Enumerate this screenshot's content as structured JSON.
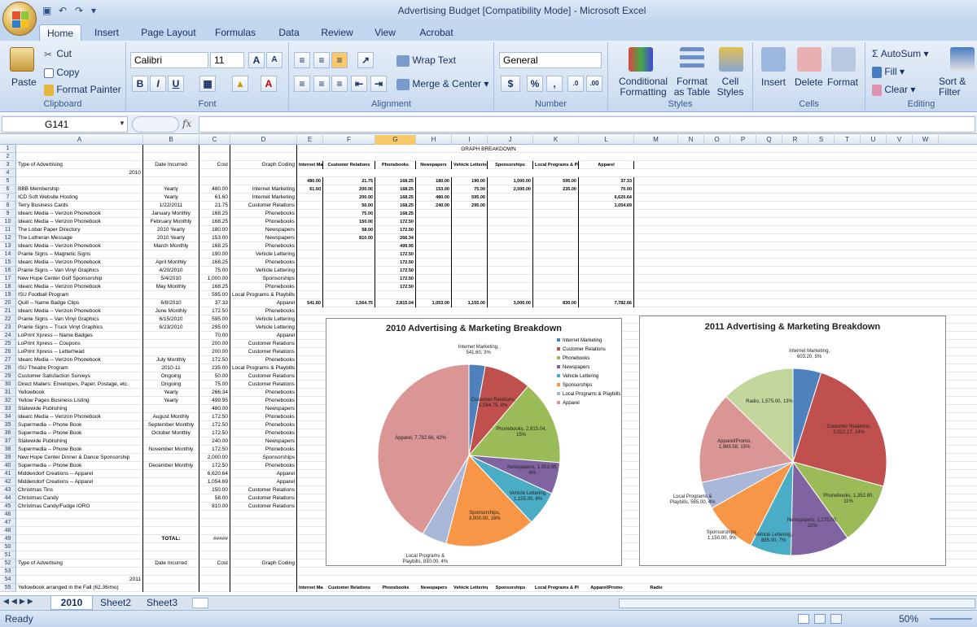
{
  "window": {
    "title": "Advertising Budget  [Compatibility Mode] - Microsoft Excel"
  },
  "ribbon": {
    "tabs": [
      "Home",
      "Insert",
      "Page Layout",
      "Formulas",
      "Data",
      "Review",
      "View",
      "Acrobat"
    ],
    "active_tab": "Home",
    "clipboard": {
      "paste": "Paste",
      "cut": "Cut",
      "copy": "Copy",
      "format_painter": "Format Painter",
      "label": "Clipboard"
    },
    "font": {
      "name": "Calibri",
      "size": "11",
      "label": "Font",
      "bold": "B",
      "italic": "I",
      "underline": "U"
    },
    "alignment": {
      "wrap": "Wrap Text",
      "merge": "Merge & Center",
      "label": "Alignment"
    },
    "number": {
      "format": "General",
      "currency": "$",
      "percent": "%",
      "comma": ",",
      "label": "Number"
    },
    "styles": {
      "conditional": "Conditional Formatting",
      "format_table": "Format as Table",
      "cell_styles": "Cell Styles",
      "label": "Styles"
    },
    "cells": {
      "insert": "Insert",
      "delete": "Delete",
      "format": "Format",
      "label": "Cells"
    },
    "editing": {
      "autosum": "AutoSum",
      "fill": "Fill",
      "clear": "Clear",
      "sort": "Sort & Filter",
      "label": "Editing"
    }
  },
  "formula_bar": {
    "name_box": "G141",
    "fx": "fx",
    "value": ""
  },
  "columns": [
    "A",
    "B",
    "C",
    "D",
    "E",
    "F",
    "G",
    "H",
    "I",
    "J",
    "K",
    "L",
    "M",
    "N",
    "O",
    "P",
    "Q",
    "R",
    "S",
    "T",
    "U",
    "V",
    "W"
  ],
  "selected_column": "G",
  "rows": [
    {
      "n": "1",
      "a": "",
      "b": "",
      "c": "",
      "d": ""
    },
    {
      "n": "2",
      "a": "",
      "b": "",
      "c": "",
      "d": ""
    },
    {
      "n": "3",
      "a": "Type of Advertising",
      "b": "Date Incurred",
      "c": "Cost",
      "d": "Graph Coding"
    },
    {
      "n": "4",
      "a": "2010",
      "b": "",
      "c": "",
      "d": ""
    },
    {
      "n": "5",
      "a": "",
      "b": "",
      "c": "",
      "d": ""
    },
    {
      "n": "6",
      "a": "BBB Membership",
      "b": "Yearly",
      "c": "480.00",
      "d": "Internet Marketing"
    },
    {
      "n": "7",
      "a": "ICD Soft Website Hosting",
      "b": "Yearly",
      "c": "61.60",
      "d": "Internet Marketing"
    },
    {
      "n": "8",
      "a": "Terry Business Cards",
      "b": "1/22/2011",
      "c": "21.75",
      "d": "Customer Relations"
    },
    {
      "n": "9",
      "a": "Idearc Media -- Verizon Phonebook",
      "b": "January Monthly",
      "c": "168.25",
      "d": "Phonebooks"
    },
    {
      "n": "10",
      "a": "Idearc Media -- Verizon Phonebook",
      "b": "February Monthly",
      "c": "168.25",
      "d": "Phonebooks"
    },
    {
      "n": "11",
      "a": "The Lobar Paper Directory",
      "b": "2010 Yearly",
      "c": "180.00",
      "d": "Newspapers"
    },
    {
      "n": "12",
      "a": "The Lutheran Message",
      "b": "2010 Yearly",
      "c": "153.00",
      "d": "Newspapers"
    },
    {
      "n": "13",
      "a": "Idearc Media -- Verizon Phonebook",
      "b": "March Monthly",
      "c": "168.25",
      "d": "Phonebooks"
    },
    {
      "n": "14",
      "a": "Prairie Signs -- Magnetic Signs",
      "b": "",
      "c": "190.00",
      "d": "Vehicle Lettering"
    },
    {
      "n": "15",
      "a": "Idearc Media -- Verizon Phonebook",
      "b": "April Monthly",
      "c": "168.25",
      "d": "Phonebooks"
    },
    {
      "n": "16",
      "a": "Prairie Signs -- Van Vinyl Graphics",
      "b": "4/20/2010",
      "c": "75.00",
      "d": "Vehicle Lettering"
    },
    {
      "n": "17",
      "a": "New Hope Center Golf Sponsorship",
      "b": "5/4/2010",
      "c": "1,000.00",
      "d": "Sponsorships"
    },
    {
      "n": "18",
      "a": "Idearc Media -- Verizon Phonebook",
      "b": "May Monthly",
      "c": "168.25",
      "d": "Phonebooks"
    },
    {
      "n": "19",
      "a": "ISU Football Program",
      "b": "",
      "c": "595.00",
      "d": "Local Programs & Playbills"
    },
    {
      "n": "20",
      "a": "Quill -- Name Badge Clips",
      "b": "6/8/2010",
      "c": "37.33",
      "d": "Apparel"
    },
    {
      "n": "21",
      "a": "Idearc Media -- Verizon Phonebook",
      "b": "June Monthly",
      "c": "172.50",
      "d": "Phonebooks"
    },
    {
      "n": "22",
      "a": "Prairie Signs -- Van Vinyl Graphics",
      "b": "6/15/2010",
      "c": "595.00",
      "d": "Vehicle Lettering"
    },
    {
      "n": "23",
      "a": "Prairie Signs -- Truck Vinyl Graphics",
      "b": "6/23/2010",
      "c": "295.00",
      "d": "Vehicle Lettering"
    },
    {
      "n": "24",
      "a": "LoPrint Xpress -- Name Badges",
      "b": "",
      "c": "70.00",
      "d": "Apparel"
    },
    {
      "n": "25",
      "a": "LoPrint Xpress -- Coupons",
      "b": "",
      "c": "200.00",
      "d": "Customer Relations"
    },
    {
      "n": "26",
      "a": "LoPrint Xpress -- Letterhead",
      "b": "",
      "c": "200.00",
      "d": "Customer Relations"
    },
    {
      "n": "27",
      "a": "Idearc Media -- Verizon Phonebook",
      "b": "July Monthly",
      "c": "172.50",
      "d": "Phonebooks"
    },
    {
      "n": "28",
      "a": "ISU Theatre Program",
      "b": "2010-11",
      "c": "235.00",
      "d": "Local Programs & Playbills"
    },
    {
      "n": "29",
      "a": "Customer Satisfaction Surveys",
      "b": "Ongoing",
      "c": "50.00",
      "d": "Customer Relations"
    },
    {
      "n": "30",
      "a": "Direct Mailers: Envelopes, Paper, Postage, etc.",
      "b": "Ongoing",
      "c": "75.00",
      "d": "Customer Relations"
    },
    {
      "n": "31",
      "a": "Yellowbook",
      "b": "Yearly",
      "c": "266.34",
      "d": "Phonebooks"
    },
    {
      "n": "32",
      "a": "Yellow Pages Business Listing",
      "b": "Yearly",
      "c": "499.95",
      "d": "Phonebooks"
    },
    {
      "n": "33",
      "a": "Statewide Publishing",
      "b": "",
      "c": "480.00",
      "d": "Newspapers"
    },
    {
      "n": "34",
      "a": "Idearc Media -- Verizon Phonebook",
      "b": "August Monthly",
      "c": "172.50",
      "d": "Phonebooks"
    },
    {
      "n": "35",
      "a": "Supermedia -- Phone Book",
      "b": "September Monthly",
      "c": "172.50",
      "d": "Phonebooks"
    },
    {
      "n": "36",
      "a": "Supermedia -- Phone Book",
      "b": "October Monthly",
      "c": "172.50",
      "d": "Phonebooks"
    },
    {
      "n": "37",
      "a": "Statewide Publishing",
      "b": "",
      "c": "240.00",
      "d": "Newspapers"
    },
    {
      "n": "38",
      "a": "Supermedia -- Phone Book",
      "b": "November Monthly",
      "c": "172.50",
      "d": "Phonebooks"
    },
    {
      "n": "39",
      "a": "New Hope Center Dinner & Dance Sponsorship",
      "b": "",
      "c": "2,000.00",
      "d": "Sponsorships"
    },
    {
      "n": "40",
      "a": "Supermedia -- Phone Book",
      "b": "December Monthly",
      "c": "172.50",
      "d": "Phonebooks"
    },
    {
      "n": "41",
      "a": "Middendorf Creations -- Apparel",
      "b": "",
      "c": "6,620.64",
      "d": "Apparel"
    },
    {
      "n": "42",
      "a": "Middendorf Creations -- Apparel",
      "b": "",
      "c": "1,054.69",
      "d": "Apparel"
    },
    {
      "n": "43",
      "a": "Christmas Tins",
      "b": "",
      "c": "150.00",
      "d": "Customer Relations"
    },
    {
      "n": "44",
      "a": "Christmas Candy",
      "b": "",
      "c": "58.00",
      "d": "Customer Relations"
    },
    {
      "n": "45",
      "a": "Christmas Candy/Fudge IORG",
      "b": "",
      "c": "810.00",
      "d": "Customer Relations"
    },
    {
      "n": "46",
      "a": "",
      "b": "",
      "c": "",
      "d": ""
    },
    {
      "n": "47",
      "a": "",
      "b": "",
      "c": "",
      "d": ""
    },
    {
      "n": "48",
      "a": "",
      "b": "",
      "c": "",
      "d": ""
    },
    {
      "n": "49",
      "a": "",
      "b": "TOTAL:",
      "c": "#####",
      "d": ""
    },
    {
      "n": "50",
      "a": "",
      "b": "",
      "c": "",
      "d": ""
    },
    {
      "n": "51",
      "a": "",
      "b": "",
      "c": "",
      "d": ""
    },
    {
      "n": "52",
      "a": "Type of Advertising",
      "b": "Date Incurred",
      "c": "Cost",
      "d": "Graph Coding"
    },
    {
      "n": "53",
      "a": "",
      "b": "",
      "c": "",
      "d": ""
    },
    {
      "n": "54",
      "a": "2011",
      "b": "",
      "c": "",
      "d": ""
    },
    {
      "n": "55",
      "a": "Yellowbook arranged in the Fall (62.36/mo)",
      "b": "",
      "c": "",
      "d": ""
    }
  ],
  "breakdown": {
    "title": "GRAPH BREAKDOWN",
    "headers": [
      "Internet Marketing",
      "Customer Relations",
      "Phonebooks",
      "Newspapers",
      "Vehicle Lettering",
      "Sponsorships",
      "Local Programs & Playbills",
      "Apparel"
    ],
    "rows": [
      [
        "480.00",
        "21.75",
        "168.25",
        "180.00",
        "190.00",
        "1,000.00",
        "595.00",
        "37.33"
      ],
      [
        "61.60",
        "200.00",
        "168.25",
        "153.00",
        "75.00",
        "2,000.00",
        "235.00",
        "70.00"
      ],
      [
        "",
        "200.00",
        "168.25",
        "480.00",
        "595.00",
        "",
        "",
        "6,620.64"
      ],
      [
        "",
        "50.00",
        "168.25",
        "240.00",
        "295.00",
        "",
        "",
        "1,054.69"
      ],
      [
        "",
        "75.00",
        "168.25",
        "",
        "",
        "",
        "",
        ""
      ],
      [
        "",
        "150.00",
        "172.50",
        "",
        "",
        "",
        "",
        ""
      ],
      [
        "",
        "58.00",
        "172.50",
        "",
        "",
        "",
        "",
        ""
      ],
      [
        "",
        "810.00",
        "266.34",
        "",
        "",
        "",
        "",
        ""
      ],
      [
        "",
        "",
        "499.95",
        "",
        "",
        "",
        "",
        ""
      ],
      [
        "",
        "",
        "172.50",
        "",
        "",
        "",
        "",
        ""
      ],
      [
        "",
        "",
        "172.50",
        "",
        "",
        "",
        "",
        ""
      ],
      [
        "",
        "",
        "172.50",
        "",
        "",
        "",
        "",
        ""
      ],
      [
        "",
        "",
        "172.50",
        "",
        "",
        "",
        "",
        ""
      ],
      [
        "",
        "",
        "172.50",
        "",
        "",
        "",
        "",
        ""
      ],
      [
        "",
        "",
        "",
        "",
        "",
        "",
        "",
        ""
      ]
    ],
    "totals": [
      "541.60",
      "1,564.75",
      "2,815.04",
      "1,053.00",
      "1,155.00",
      "3,000.00",
      "830.00",
      "7,782.66"
    ],
    "row55_headers": [
      "Internet Marketing",
      "Customer Relations",
      "Phonebooks",
      "Newspapers",
      "Vehicle Lettering",
      "Sponsorships",
      "Local Programs & Playbills",
      "Apparel/Promo",
      "Radio"
    ]
  },
  "chart_data": [
    {
      "type": "pie",
      "title": "2010 Advertising & Marketing Breakdown",
      "categories": [
        "Internet Marketing",
        "Customer Relations",
        "Phonebooks",
        "Newspapers",
        "Vehicle Lettering",
        "Sponsorships",
        "Local Programs & Playbills",
        "Apparel"
      ],
      "values": [
        541.6,
        1564.75,
        2815.04,
        1053.0,
        1155.0,
        3000.0,
        830.0,
        7782.66
      ],
      "labels": [
        "Internet Marketing, 541.60, 3%",
        "Customer Relations, 1,564.75, 8%",
        "Phonebooks, 2,815.04, 15%",
        "Newspapers, 1,053.00, 6%",
        "Vehicle Lettering, 1,155.00, 6%",
        "Sponsorships, 3,000.00, 16%",
        "Local Programs & Playbills, 830.00, 4%",
        "Apparel, 7,782.66, 42%"
      ],
      "colors": [
        "#4f81bd",
        "#c0504d",
        "#9bbb59",
        "#8064a2",
        "#4bacc6",
        "#f79646",
        "#a9b8d9",
        "#d99694"
      ],
      "legend": [
        "Internet Marketing",
        "Customer Relations",
        "Phonebooks",
        "Newspapers",
        "Vehicle Lettering",
        "Sponsorships",
        "Local Programs & Playbills",
        "Apparel"
      ],
      "legend_position": "right"
    },
    {
      "type": "pie",
      "title": "2011 Advertising & Marketing Breakdown",
      "categories": [
        "Internet Marketing",
        "Customer Relations",
        "Phonebooks",
        "Newspapers",
        "Vehicle Lettering",
        "Sponsorships",
        "Local Programs & Playbills",
        "Apparel/Promo",
        "Radio"
      ],
      "values": [
        603.2,
        3022.17,
        1352.8,
        1275.0,
        885.0,
        1150.0,
        585.0,
        1969.58,
        1575.0
      ],
      "labels": [
        "Internet Marketing, 603.20, 5%",
        "Customer Relations, 3,022.17, 24%",
        "Phonebooks, 1,352.80, 11%",
        "Newspapers, 1,275.00, 10%",
        "Vehicle Lettering, 885.00, 7%",
        "Sponsorships, 1,150.00, 9%",
        "Local Programs & Playbills, 585.00, 4%",
        "Apparel/Promo, 1,969.58, 15%",
        "Radio, 1,575.00, 13%"
      ],
      "colors": [
        "#4f81bd",
        "#c0504d",
        "#9bbb59",
        "#8064a2",
        "#4bacc6",
        "#f79646",
        "#a9b8d9",
        "#d99694",
        "#c3d69b"
      ],
      "legend_position": "none"
    }
  ],
  "sheets": [
    "2010",
    "Sheet2",
    "Sheet3"
  ],
  "active_sheet": "2010",
  "status": {
    "ready": "Ready",
    "zoom": "50%"
  }
}
